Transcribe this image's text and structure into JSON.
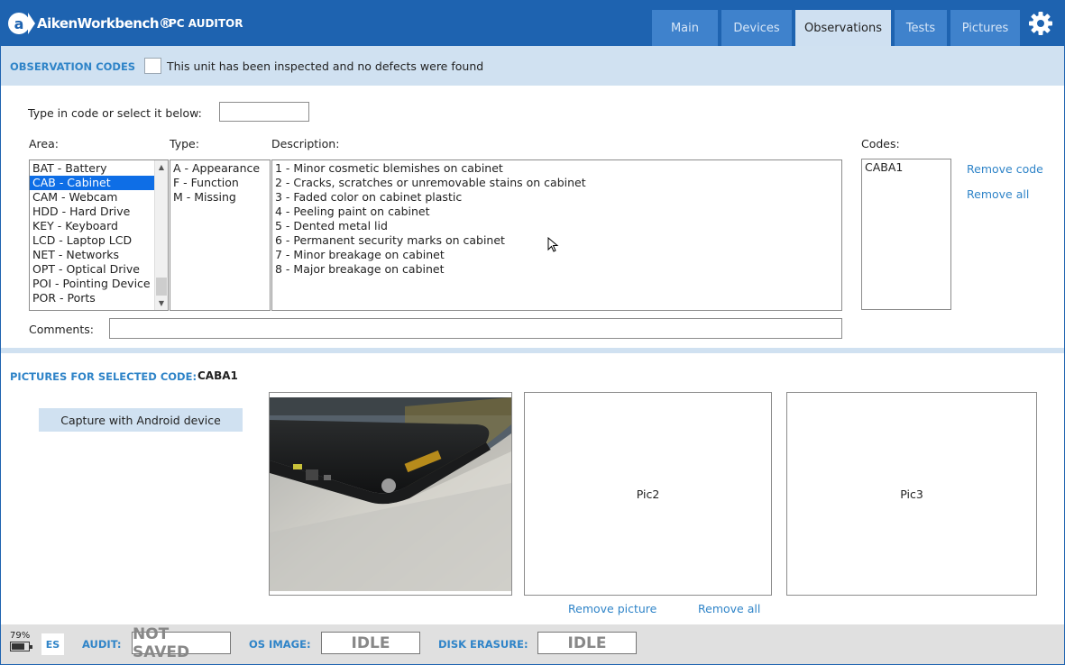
{
  "header": {
    "logo_text": "AikenWorkbench®",
    "app_name": "PC AUDITOR",
    "tabs": [
      {
        "label": "Main",
        "active": false
      },
      {
        "label": "Devices",
        "active": false
      },
      {
        "label": "Observations",
        "active": true
      },
      {
        "label": "Tests",
        "active": false
      },
      {
        "label": "Pictures",
        "active": false
      }
    ],
    "settings_icon": "gear-icon"
  },
  "observation": {
    "title": "OBSERVATION CODES",
    "no_defects_label": "This unit has been inspected and no defects were found",
    "no_defects_checked": false,
    "code_input_label": "Type in code or select it below:",
    "code_input_value": "",
    "area_label": "Area:",
    "type_label": "Type:",
    "description_label": "Description:",
    "codes_label": "Codes:",
    "areas": [
      {
        "label": "BAT - Battery",
        "selected": false
      },
      {
        "label": "CAB - Cabinet",
        "selected": true
      },
      {
        "label": "CAM - Webcam",
        "selected": false
      },
      {
        "label": "HDD - Hard Drive",
        "selected": false
      },
      {
        "label": "KEY - Keyboard",
        "selected": false
      },
      {
        "label": "LCD - Laptop LCD",
        "selected": false
      },
      {
        "label": "NET - Networks",
        "selected": false
      },
      {
        "label": "OPT - Optical Drive",
        "selected": false
      },
      {
        "label": "POI - Pointing Device",
        "selected": false
      },
      {
        "label": "POR - Ports",
        "selected": false
      }
    ],
    "types": [
      "A - Appearance",
      "F - Function",
      "M - Missing"
    ],
    "descriptions": [
      "1 - Minor cosmetic blemishes on cabinet",
      "2 - Cracks, scratches or unremovable stains on cabinet",
      "3 - Faded color on cabinet plastic",
      "4 - Peeling paint on cabinet",
      "5 - Dented metal lid",
      "6 - Permanent security marks on cabinet",
      "7 - Minor breakage on cabinet",
      "8 - Major breakage on cabinet"
    ],
    "codes": [
      "CABA1"
    ],
    "remove_code_label": "Remove code",
    "remove_all_label": "Remove all",
    "comments_label": "Comments:",
    "comments_value": ""
  },
  "pictures": {
    "title": "PICTURES FOR SELECTED CODE:",
    "selected_code": "CABA1",
    "capture_button": "Capture with Android device",
    "pic2_label": "Pic2",
    "pic3_label": "Pic3",
    "remove_picture_label": "Remove picture",
    "remove_all_label": "Remove all"
  },
  "status": {
    "battery_percent": "79%",
    "battery_level": 0.79,
    "language": "ES",
    "audit_label": "AUDIT:",
    "audit_value": "NOT SAVED",
    "os_image_label": "OS IMAGE:",
    "os_image_value": "IDLE",
    "disk_erasure_label": "DISK ERASURE:",
    "disk_erasure_value": "IDLE"
  },
  "colors": {
    "brand_blue": "#1e63b0",
    "tab_blue": "#3f82cc",
    "light_blue": "#d0e1f1",
    "accent_text": "#2f84c8",
    "selection": "#0e6ee6"
  }
}
